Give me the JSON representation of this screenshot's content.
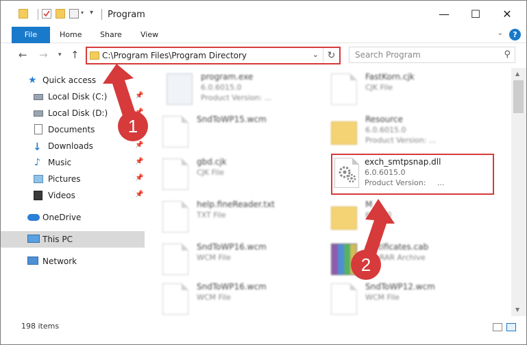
{
  "window": {
    "title": "Program",
    "controls": {
      "minimize": "—",
      "maximize": "☐",
      "close": "✕"
    }
  },
  "ribbon": {
    "tabs": [
      "File",
      "Home",
      "Share",
      "View"
    ],
    "help": "?"
  },
  "address": {
    "path": "C:\\Program Files\\Program Directory",
    "search_placeholder": "Search Program"
  },
  "sidebar": {
    "items": [
      {
        "label": "Quick access",
        "icon": "star-icon"
      },
      {
        "label": "Local Disk (C:)",
        "icon": "drive-icon"
      },
      {
        "label": "Local Disk (D:)",
        "icon": "drive-icon"
      },
      {
        "label": "Documents",
        "icon": "documents-icon"
      },
      {
        "label": "Downloads",
        "icon": "download-icon"
      },
      {
        "label": "Music",
        "icon": "music-icon"
      },
      {
        "label": "Pictures",
        "icon": "pictures-icon"
      },
      {
        "label": "Videos",
        "icon": "videos-icon"
      },
      {
        "label": "OneDrive",
        "icon": "cloud-icon"
      },
      {
        "label": "This PC",
        "icon": "computer-icon"
      },
      {
        "label": "Network",
        "icon": "network-icon"
      }
    ]
  },
  "files": [
    {
      "name": "program.exe",
      "l2": "6.0.6015.0",
      "l3": "Product Version: ...",
      "kind": "exe"
    },
    {
      "name": "FastKorn.cjk",
      "l2": "CJK File",
      "l3": "",
      "kind": "doc"
    },
    {
      "name": "SndToWP15.wcm",
      "l2": "",
      "l3": "",
      "kind": "doc"
    },
    {
      "name": "Resource",
      "l2": "6.0.6015.0",
      "l3": "Product Version: ...",
      "kind": "folder"
    },
    {
      "name": "gbd.cjk",
      "l2": "CJK File",
      "l3": "",
      "kind": "doc"
    },
    {
      "name": "exch_smtpsnap.dll",
      "l2": "6.0.6015.0",
      "l3": "Product Version:",
      "l3b": "...",
      "kind": "dll"
    },
    {
      "name": "help.fineReader.txt",
      "l2": "TXT File",
      "l3": "",
      "kind": "doc"
    },
    {
      "name": "M",
      "l2": "6015.0",
      "l3": "",
      "kind": "folder"
    },
    {
      "name": "SndToWP16.wcm",
      "l2": "WCM File",
      "l3": "",
      "kind": "doc"
    },
    {
      "name": "certificates.cab",
      "l2": "WinRAR Archive",
      "l3": "",
      "kind": "rar"
    },
    {
      "name": "SndToWP16.wcm",
      "l2": "WCM File",
      "l3": "",
      "kind": "doc"
    },
    {
      "name": "SndToWP12.wcm",
      "l2": "WCM File",
      "l3": "",
      "kind": "doc"
    }
  ],
  "status": {
    "count": "198 items"
  },
  "annotations": {
    "step1": "1",
    "step2": "2"
  },
  "colors": {
    "accent": "#1979ca",
    "highlight": "#d63a3a",
    "folder": "#f3cc5c"
  }
}
